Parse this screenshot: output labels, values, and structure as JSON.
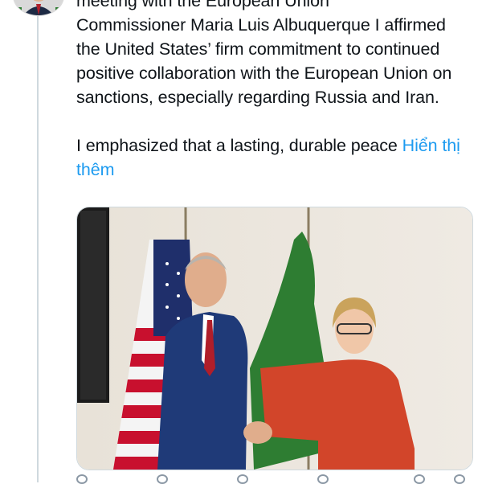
{
  "tweet": {
    "partial_top_line": "meeting with the European Union",
    "paragraph1": "Commissioner Maria Luis Albuquerque I affirmed the United States’ firm commitment to continued positive collaboration with the European Union on sanctions, especially regarding Russia and Iran.",
    "paragraph2": "I emphasized that a lasting, durable peace",
    "show_more_label": "Hiển thị thêm"
  },
  "icons": {
    "avatar": "profile-photo",
    "actions": [
      "reply-icon",
      "repost-icon",
      "like-icon",
      "views-icon",
      "bookmark-icon",
      "share-icon"
    ]
  },
  "colors": {
    "link": "#1d9bf0",
    "text": "#0f1419",
    "thread_line": "#cfd9de"
  }
}
